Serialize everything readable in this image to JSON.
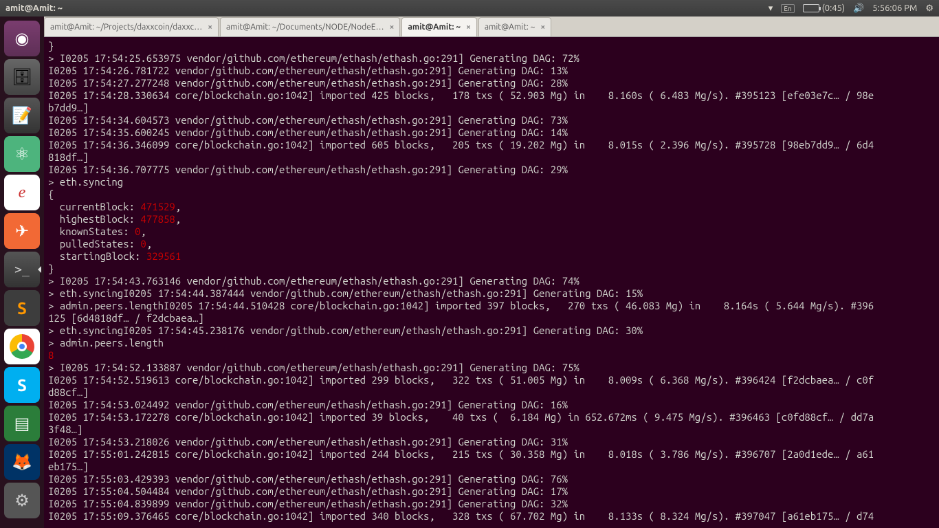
{
  "topbar": {
    "title": "amit@Amit: ~",
    "lang": "En",
    "battery_time": "(0:45)",
    "time": "5:56:06 PM"
  },
  "tabs": [
    {
      "label": "amit@Amit: ~/Projects/daxxcoin/daxxc…",
      "close": "×"
    },
    {
      "label": "amit@Amit: ~/Documents/NODE/NodeE…",
      "close": "×"
    },
    {
      "label": "amit@Amit: ~",
      "close": "×",
      "active": true
    },
    {
      "label": "amit@Amit: ~",
      "close": "×"
    }
  ],
  "launcher": {
    "ubuntu": "◉",
    "files": "🗄",
    "gedit": "📝",
    "atom": "⚛",
    "reader": "e",
    "postman": "✈",
    "term": ">_",
    "subl": "S",
    "chrome": "◐",
    "skype": "S",
    "libre": "▤",
    "firefox": "🦊",
    "sys": "⚙"
  },
  "term": {
    "l1": "}",
    "l2": "> I0205 17:54:25.653975 vendor/github.com/ethereum/ethash/ethash.go:291] Generating DAG: 72%",
    "l3": "I0205 17:54:26.781722 vendor/github.com/ethereum/ethash/ethash.go:291] Generating DAG: 13%",
    "l4": "I0205 17:54:27.277248 vendor/github.com/ethereum/ethash/ethash.go:291] Generating DAG: 28%",
    "l5": "I0205 17:54:28.330634 core/blockchain.go:1042] imported 425 blocks,   178 txs ( 52.903 Mg) in    8.160s ( 6.483 Mg/s). #395123 [efe03e7c… / 98e",
    "l5b": "b7dd9…]",
    "l6": "I0205 17:54:34.604573 vendor/github.com/ethereum/ethash/ethash.go:291] Generating DAG: 73%",
    "l7": "I0205 17:54:35.600245 vendor/github.com/ethereum/ethash/ethash.go:291] Generating DAG: 14%",
    "l8": "I0205 17:54:36.346099 core/blockchain.go:1042] imported 605 blocks,   205 txs ( 19.202 Mg) in    8.015s ( 2.396 Mg/s). #395728 [98eb7dd9… / 6d4",
    "l8b": "818df…]",
    "l9": "I0205 17:54:36.707775 vendor/github.com/ethereum/ethash/ethash.go:291] Generating DAG: 29%",
    "l10": "> eth.syncing",
    "l11": "{",
    "l12a": "  currentBlock: ",
    "l12b": "471529",
    "l12c": ",",
    "l13a": "  highestBlock: ",
    "l13b": "477858",
    "l13c": ",",
    "l14a": "  knownStates: ",
    "l14b": "0",
    "l14c": ",",
    "l15a": "  pulledStates: ",
    "l15b": "0",
    "l15c": ",",
    "l16a": "  startingBlock: ",
    "l16b": "329561",
    "l17": "}",
    "l18": "> I0205 17:54:43.763146 vendor/github.com/ethereum/ethash/ethash.go:291] Generating DAG: 74%",
    "l19": "> eth.syncingI0205 17:54:44.387444 vendor/github.com/ethereum/ethash/ethash.go:291] Generating DAG: 15%",
    "l20": "> admin.peers.lengthI0205 17:54:44.510428 core/blockchain.go:1042] imported 397 blocks,   270 txs ( 46.083 Mg) in    8.164s ( 5.644 Mg/s). #396",
    "l20b": "125 [6d4818df… / f2dcbaea…]",
    "l21": "> eth.syncingI0205 17:54:45.238176 vendor/github.com/ethereum/ethash/ethash.go:291] Generating DAG: 30%",
    "l22": "> admin.peers.length",
    "l23": "8",
    "l24": "> I0205 17:54:52.133887 vendor/github.com/ethereum/ethash/ethash.go:291] Generating DAG: 75%",
    "l25": "I0205 17:54:52.519613 core/blockchain.go:1042] imported 299 blocks,   322 txs ( 51.005 Mg) in    8.009s ( 6.368 Mg/s). #396424 [f2dcbaea… / c0f",
    "l25b": "d88cf…]",
    "l26": "I0205 17:54:53.024492 vendor/github.com/ethereum/ethash/ethash.go:291] Generating DAG: 16%",
    "l27": "I0205 17:54:53.172278 core/blockchain.go:1042] imported 39 blocks,    40 txs (  6.184 Mg) in 652.672ms ( 9.475 Mg/s). #396463 [c0fd88cf… / dd7a",
    "l27b": "3f48…]",
    "l28": "I0205 17:54:53.218026 vendor/github.com/ethereum/ethash/ethash.go:291] Generating DAG: 31%",
    "l29": "I0205 17:55:01.242815 core/blockchain.go:1042] imported 244 blocks,   215 txs ( 30.358 Mg) in    8.018s ( 3.786 Mg/s). #396707 [2a0d1ede… / a61",
    "l29b": "eb175…]",
    "l30": "I0205 17:55:03.429393 vendor/github.com/ethereum/ethash/ethash.go:291] Generating DAG: 76%",
    "l31": "I0205 17:55:04.504484 vendor/github.com/ethereum/ethash/ethash.go:291] Generating DAG: 17%",
    "l32": "I0205 17:55:04.839899 vendor/github.com/ethereum/ethash/ethash.go:291] Generating DAG: 32%",
    "l33": "I0205 17:55:09.376465 core/blockchain.go:1042] imported 340 blocks,   328 txs ( 67.702 Mg) in    8.133s ( 8.324 Mg/s). #397047 [a61eb175… / d74"
  }
}
